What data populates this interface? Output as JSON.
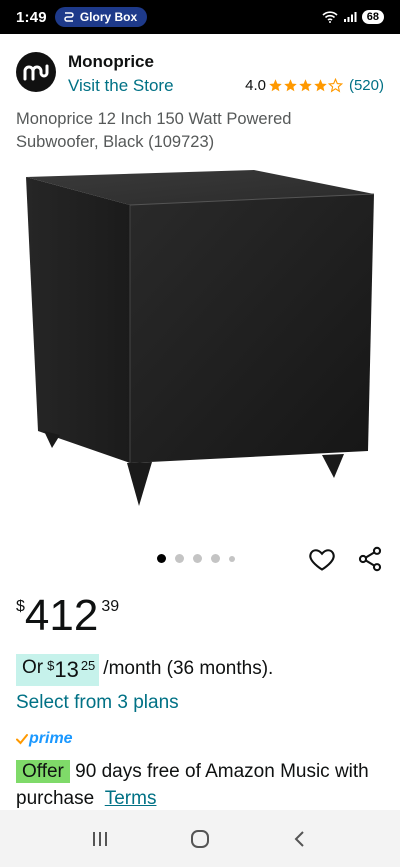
{
  "status_bar": {
    "time": "1:49",
    "notification": "Glory Box",
    "battery": "68"
  },
  "brand": {
    "name": "Monoprice",
    "visit_store": "Visit the Store",
    "rating_value": "4.0",
    "rating_stars": 4.0,
    "rating_count": "(520)"
  },
  "product": {
    "title": "Monoprice 12 Inch 150 Watt Powered Subwoofer, Black (109723)",
    "image_count": 5,
    "current_image": 1
  },
  "price": {
    "symbol": "$",
    "whole": "412",
    "fraction": "39"
  },
  "monthly": {
    "prefix": "Or",
    "symbol": "$",
    "whole": "13",
    "fraction": "25",
    "suffix": "/month (36 months)."
  },
  "plans_link": "Select from 3 plans",
  "prime_label": "prime",
  "offer": {
    "badge": "Offer",
    "text": "90 days free of Amazon Music with purchase",
    "terms_link": "Terms"
  },
  "colors": {
    "link": "#007185",
    "star": "#ff9900",
    "monthly_bg": "#c6f2eb",
    "offer_bg": "#7fda69",
    "prime": "#1a98ff"
  },
  "icons": {
    "wishlist": "heart-icon",
    "share": "share-icon",
    "nav_recent": "recent-apps-icon",
    "nav_home": "home-icon",
    "nav_back": "back-icon"
  }
}
